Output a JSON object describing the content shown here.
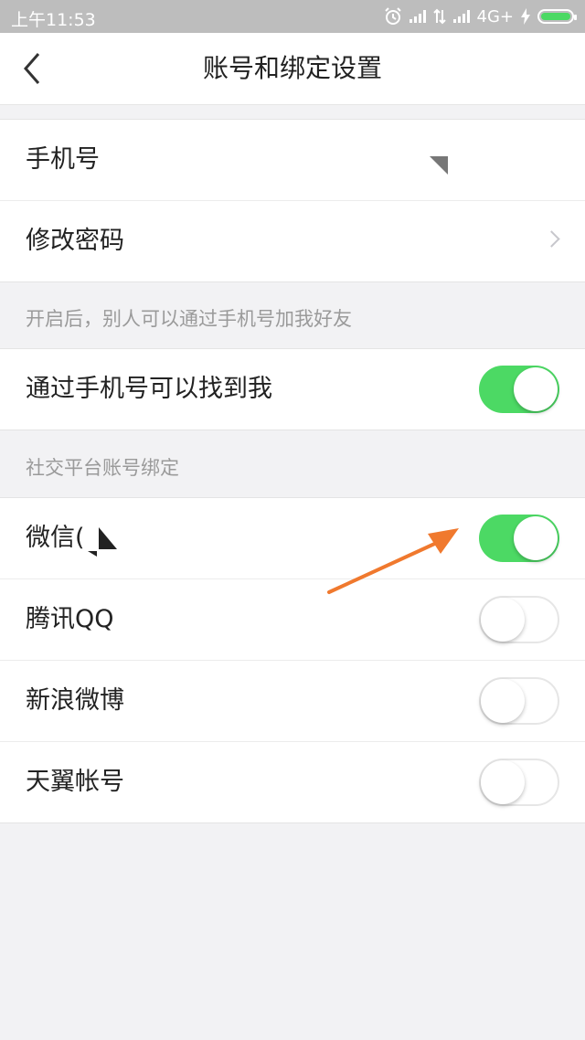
{
  "status_bar": {
    "time": "上午11:53",
    "network": "4G+"
  },
  "header": {
    "title": "账号和绑定设置"
  },
  "account": {
    "phone_label": "手机号",
    "password_label": "修改密码"
  },
  "phone_hint": "开启后，别人可以通过手机号加我好友",
  "find_me": {
    "label": "通过手机号可以找到我",
    "on": true
  },
  "social_header": "社交平台账号绑定",
  "social": [
    {
      "label": "微信(",
      "on": true
    },
    {
      "label": "腾讯QQ",
      "on": false
    },
    {
      "label": "新浪微博",
      "on": false
    },
    {
      "label": "天翼帐号",
      "on": false
    }
  ],
  "colors": {
    "toggle_on": "#4cd964",
    "annotation_arrow": "#f0792e"
  }
}
